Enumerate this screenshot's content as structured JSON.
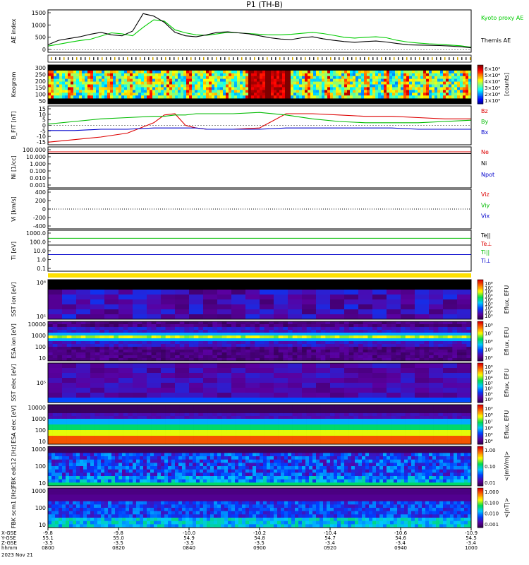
{
  "title": "P1 (TH-B)",
  "chart_data": [
    {
      "type": "line",
      "panel": "AE index",
      "ylabel": "AE index",
      "ylim": [
        -100,
        1600
      ],
      "yticks": [
        "1500",
        "1000",
        "500",
        "0"
      ],
      "x": [
        1300,
        1302,
        1304,
        1306,
        1308,
        1310,
        1312,
        1314,
        1316,
        1318,
        1320,
        1322,
        1324,
        1326,
        1328,
        1330,
        1332,
        1334,
        1336,
        1338,
        1340,
        1342,
        1344,
        1346,
        1348,
        1350,
        1352,
        1354,
        1356,
        1358,
        1360,
        1362,
        1364,
        1366,
        1368,
        1370,
        1372,
        1374,
        1376,
        1378,
        1380
      ],
      "series": [
        {
          "name": "Kyoto proxy AE",
          "color": "#00cc00",
          "values": [
            150,
            220,
            300,
            370,
            420,
            550,
            680,
            640,
            560,
            900,
            1200,
            1150,
            800,
            680,
            600,
            580,
            640,
            700,
            680,
            650,
            620,
            600,
            600,
            620,
            660,
            700,
            650,
            580,
            500,
            470,
            500,
            520,
            480,
            380,
            310,
            270,
            240,
            220,
            190,
            160,
            100
          ]
        },
        {
          "name": "Themis AE",
          "color": "#000000",
          "values": [
            200,
            380,
            450,
            520,
            620,
            700,
            600,
            560,
            750,
            1450,
            1350,
            1100,
            700,
            560,
            520,
            600,
            700,
            720,
            680,
            640,
            560,
            480,
            430,
            410,
            480,
            520,
            440,
            380,
            330,
            300,
            330,
            350,
            310,
            250,
            200,
            190,
            180,
            170,
            150,
            120,
            80
          ]
        }
      ]
    },
    {
      "type": "heatmap",
      "panel": "Keogram",
      "ylabel": "Keogram",
      "yticks": [
        "300",
        "250",
        "200",
        "150",
        "100",
        "50"
      ],
      "colorbar_ticks": [
        "6×10⁴",
        "5×10⁴",
        "4×10⁴",
        "3×10⁴",
        "2×10⁴",
        "1×10⁴"
      ],
      "colorbar_label": "[counts]"
    },
    {
      "type": "line",
      "panel": "B_FIT GSE",
      "ylabel": "B_FIT [nT]",
      "ylim": [
        -15,
        15
      ],
      "yticks": [
        "15",
        "10",
        "5",
        "0",
        "-5",
        "-10",
        "-15"
      ],
      "x": [
        1300,
        1305,
        1310,
        1315,
        1320,
        1322,
        1324,
        1326,
        1328,
        1330,
        1335,
        1340,
        1345,
        1350,
        1355,
        1360,
        1365,
        1370,
        1375,
        1380
      ],
      "series": [
        {
          "name": "Bz",
          "color": "#dd0000",
          "values": [
            -13,
            -11,
            -9,
            -6,
            2,
            8,
            9,
            0,
            -2,
            -3,
            -3,
            -2,
            9,
            9,
            8,
            7,
            7,
            6,
            5,
            5
          ]
        },
        {
          "name": "By",
          "color": "#00bb00",
          "values": [
            1,
            3,
            5,
            6,
            7,
            7,
            8,
            8,
            9,
            9,
            9,
            10,
            8,
            5,
            3,
            2,
            2,
            2,
            3,
            4
          ]
        },
        {
          "name": "Bx",
          "color": "#0000cc",
          "values": [
            -4,
            -4,
            -3,
            -3,
            -2,
            -2,
            -2,
            -2,
            -2,
            -3,
            -3,
            -3,
            -2,
            -2,
            -2,
            -2,
            -2,
            -3,
            -3,
            -3
          ]
        }
      ]
    },
    {
      "type": "line",
      "panel": "Ni",
      "ylabel": "Ni [1/cc]",
      "log": true,
      "ylim": [
        0.001,
        100
      ],
      "yticks": [
        "100.000",
        "10.000",
        "1.000",
        "0.100",
        "0.010",
        "0.001"
      ],
      "series": [
        {
          "name": "Ne",
          "color": "#dd0000",
          "value": 25
        },
        {
          "name": "Ni",
          "color": "#000000",
          "value": 15
        },
        {
          "name": "Npot",
          "color": "#0000cc",
          "value": null
        }
      ]
    },
    {
      "type": "line",
      "panel": "Vi",
      "ylabel": "Vi [km/s]",
      "ylim": [
        -500,
        500
      ],
      "yticks": [
        "400",
        "200",
        "0",
        "-200",
        "-400"
      ],
      "series": [
        {
          "name": "Viz",
          "color": "#dd0000"
        },
        {
          "name": "Viy",
          "color": "#00bb00"
        },
        {
          "name": "Vix",
          "color": "#0000cc"
        }
      ]
    },
    {
      "type": "line",
      "panel": "Ti",
      "ylabel": "Ti [eV]",
      "log": true,
      "ylim": [
        0.1,
        5000
      ],
      "yticks": [
        "1000.0",
        "100.0",
        "10.0",
        "1.0",
        "0.1"
      ],
      "series": [
        {
          "name": "Te||",
          "color": "#000000",
          "value": 100
        },
        {
          "name": "Te⊥",
          "color": "#dd0000",
          "value": null
        },
        {
          "name": "Ti||",
          "color": "#00bb00",
          "value": 600
        },
        {
          "name": "Ti⊥",
          "color": "#0000cc",
          "value": 8
        }
      ]
    },
    {
      "type": "heatmap",
      "panel": "SST ion",
      "ylabel": "SST ion [eV]",
      "yticks": [
        "10⁶",
        "10⁵"
      ],
      "colorbar_ticks": [
        "10⁸",
        "10⁷",
        "10⁶",
        "10⁵",
        "10⁴",
        "10³",
        "10²",
        "10¹",
        "10⁰"
      ],
      "colorbar_label": "Eflux, EFU"
    },
    {
      "type": "heatmap",
      "panel": "ESA ion",
      "ylabel": "ESA ion [eV]",
      "yticks": [
        "10000",
        "1000",
        "100",
        "10"
      ],
      "colorbar_ticks": [
        "10⁸",
        "10⁷",
        "10⁶",
        "10⁵",
        "10⁴"
      ],
      "colorbar_label": "Eflux, EFU"
    },
    {
      "type": "heatmap",
      "panel": "SST elec",
      "ylabel": "SST elec [eV]",
      "yticks": [
        "10⁵"
      ],
      "colorbar_ticks": [
        "10⁶",
        "10⁵",
        "10⁴",
        "10³",
        "10²",
        "10¹",
        "10⁰"
      ],
      "colorbar_label": "Eflux, EFU"
    },
    {
      "type": "heatmap",
      "panel": "ESA elec",
      "ylabel": "ESA elec [eV]",
      "yticks": [
        "10000",
        "1000",
        "100",
        "10"
      ],
      "colorbar_ticks": [
        "10⁹",
        "10⁸",
        "10⁷",
        "10⁶",
        "10⁵",
        "10⁴"
      ],
      "colorbar_label": "Eflux, EFU"
    },
    {
      "type": "heatmap",
      "panel": "FBK E",
      "ylabel": "FBK edc12 [Hz]",
      "yticks": [
        "1000",
        "100",
        "10"
      ],
      "colorbar_ticks": [
        "1.00",
        "0.10",
        "0.01"
      ],
      "colorbar_label": "<|mV/m|>"
    },
    {
      "type": "heatmap",
      "panel": "FBK B",
      "ylabel": "FBK scm1 [Hz]",
      "yticks": [
        "1000",
        "100",
        "10"
      ],
      "colorbar_ticks": [
        "1.000",
        "0.100",
        "0.010",
        "0.001"
      ],
      "colorbar_label": "<|nT|>"
    }
  ],
  "footer": {
    "row_labels": [
      "X-GSE",
      "Y-GSE",
      "Z-GSE",
      "hhmm",
      "2023 Nov 21"
    ],
    "columns": [
      [
        "-9.8",
        "55.1",
        "-3.5",
        "0800"
      ],
      [
        "-9.8",
        "55.0",
        "-3.5",
        "0820"
      ],
      [
        "-10.0",
        "54.9",
        "-3.5",
        "0840"
      ],
      [
        "-10.2",
        "54.8",
        "-3.5",
        "0900"
      ],
      [
        "-10.4",
        "54.7",
        "-3.4",
        "0920"
      ],
      [
        "-10.6",
        "54.6",
        "-3.4",
        "0940"
      ],
      [
        "-10.9",
        "54.5",
        "-3.4",
        "1000"
      ]
    ]
  }
}
